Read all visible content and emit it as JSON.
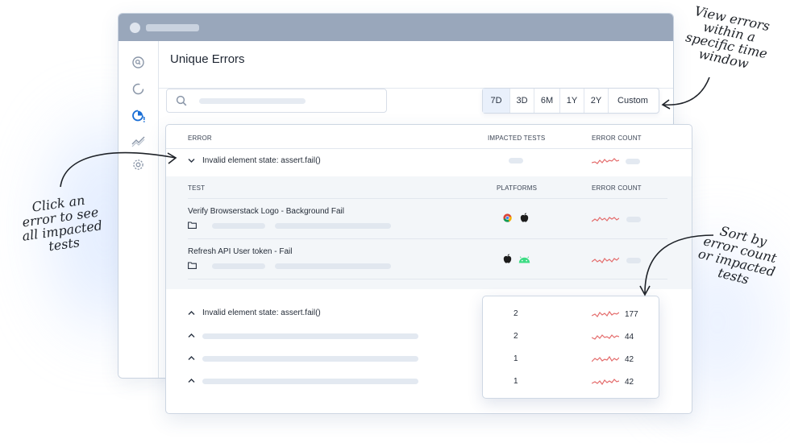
{
  "page": {
    "title": "Unique Errors"
  },
  "time_range": {
    "options": [
      "7D",
      "3D",
      "6M",
      "1Y",
      "2Y",
      "Custom"
    ],
    "selected": "7D"
  },
  "errors_table": {
    "headers": {
      "error": "ERROR",
      "impacted_tests": "IMPACTED TESTS",
      "error_count": "ERROR COUNT"
    },
    "first_error": {
      "label": "Invalid element state: assert.fail()"
    },
    "sub_table": {
      "headers": {
        "test": "TEST",
        "platforms": "PLATFORMS",
        "error_count": "ERROR COUNT"
      },
      "rows": [
        {
          "name": "Verify Browserstack Logo - Background Fail",
          "platform_icons": [
            "chrome-icon",
            "apple-icon"
          ]
        },
        {
          "name": "Refresh API User token - Fail",
          "platform_icons": [
            "apple-icon",
            "android-icon"
          ]
        }
      ]
    },
    "second_error": {
      "label": "Invalid element state: assert.fail()"
    }
  },
  "sort_popup": {
    "rows": [
      {
        "impacted": "2",
        "count": "177"
      },
      {
        "impacted": "2",
        "count": "44"
      },
      {
        "impacted": "1",
        "count": "42"
      },
      {
        "impacted": "1",
        "count": "42"
      }
    ]
  },
  "annotations": {
    "time_window": "View errors\nwithin a\nspecific time\nwindow",
    "click_error": "Click an\nerror to see\nall impacted\ntests",
    "sort": "Sort by\nerror count\nor impacted\ntests"
  },
  "colors": {
    "accent": "#1a6fd6",
    "sparkline": "#e46c6c",
    "titlebar": "#99a7bb"
  }
}
